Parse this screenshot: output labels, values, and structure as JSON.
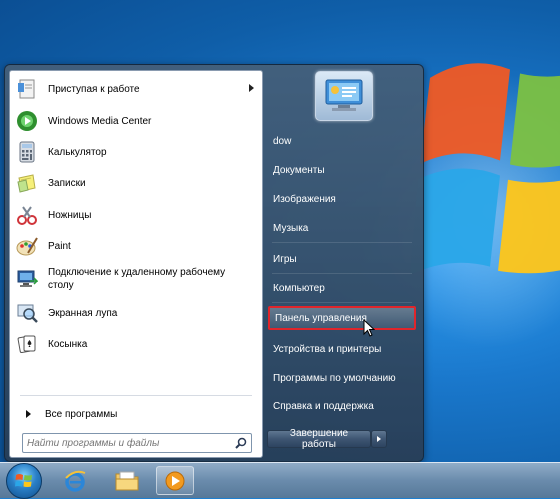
{
  "programs": [
    {
      "label": "Приступая к работе",
      "icon": "getting-started-icon",
      "has_submenu": true
    },
    {
      "label": "Windows Media Center",
      "icon": "media-center-icon"
    },
    {
      "label": "Калькулятор",
      "icon": "calculator-icon"
    },
    {
      "label": "Записки",
      "icon": "sticky-notes-icon"
    },
    {
      "label": "Ножницы",
      "icon": "snipping-tool-icon"
    },
    {
      "label": "Paint",
      "icon": "paint-icon"
    },
    {
      "label": "Подключение к удаленному рабочему столу",
      "icon": "remote-desktop-icon"
    },
    {
      "label": "Экранная лупа",
      "icon": "magnifier-icon"
    },
    {
      "label": "Косынка",
      "icon": "solitaire-icon"
    }
  ],
  "all_programs_label": "Все программы",
  "search": {
    "placeholder": "Найти программы и файлы",
    "icon": "search-icon"
  },
  "places": [
    {
      "label": "dow"
    },
    {
      "label": "Документы"
    },
    {
      "label": "Изображения"
    },
    {
      "label": "Музыка"
    },
    {
      "label": "Игры"
    },
    {
      "label": "Компьютер"
    },
    {
      "label": "Панель управления",
      "highlighted": true
    },
    {
      "label": "Устройства и принтеры"
    },
    {
      "label": "Программы по умолчанию"
    },
    {
      "label": "Справка и поддержка"
    }
  ],
  "shutdown_label": "Завершение работы",
  "taskbar": {
    "items": [
      "start-orb-icon",
      "internet-explorer-icon",
      "explorer-folder-icon",
      "media-player-icon"
    ]
  },
  "colors": {
    "highlight_border": "#e0252b",
    "menu_bg": "#3b5572"
  }
}
